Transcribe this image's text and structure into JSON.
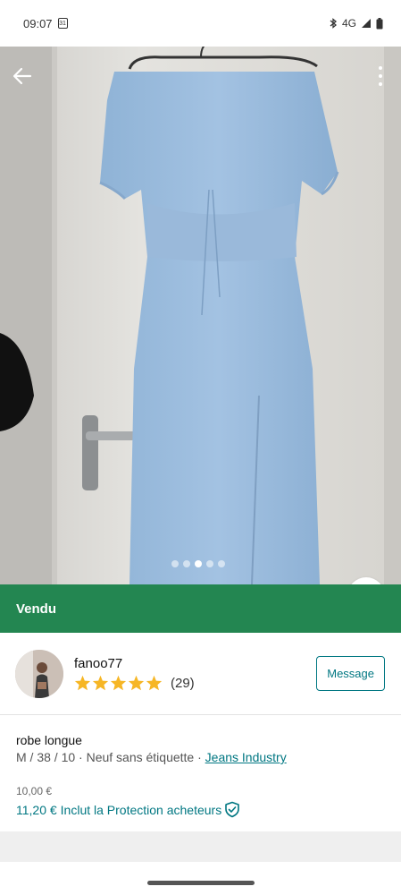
{
  "status_bar": {
    "time": "09:07",
    "calendar_day": "31",
    "network": "4G"
  },
  "gallery": {
    "page_count": 5,
    "active_index": 2
  },
  "sold_banner": {
    "label": "Vendu"
  },
  "seller": {
    "username": "fanoo77",
    "rating_stars": 5,
    "review_count": "(29)",
    "message_label": "Message"
  },
  "item": {
    "title": "robe longue",
    "meta": "M / 38 / 10 · Neuf sans étiquette · ",
    "brand": "Jeans Industry",
    "price_original": "10,00 €",
    "price_total": "11,20 €",
    "protection_label": "Inclut la Protection acheteurs"
  },
  "colors": {
    "sold_green": "#238651",
    "accent_teal": "#007782",
    "star_yellow": "#F6B625"
  }
}
